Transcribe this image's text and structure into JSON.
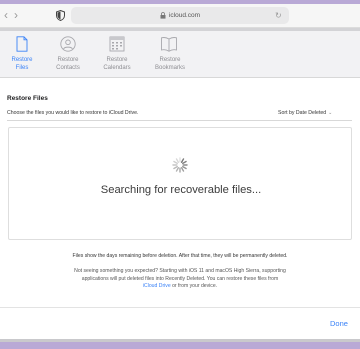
{
  "browser": {
    "url": "icloud.com",
    "back_icon": "chevron-left-icon",
    "forward_icon": "chevron-right-icon"
  },
  "tabs": [
    {
      "label_line1": "Restore",
      "label_line2": "Files",
      "icon": "document-icon",
      "active": true
    },
    {
      "label_line1": "Restore",
      "label_line2": "Contacts",
      "icon": "contacts-icon",
      "active": false
    },
    {
      "label_line1": "Restore",
      "label_line2": "Calendars",
      "icon": "calendar-icon",
      "active": false
    },
    {
      "label_line1": "Restore",
      "label_line2": "Bookmarks",
      "icon": "book-icon",
      "active": false
    }
  ],
  "main": {
    "title": "Restore Files",
    "instructions": "Choose the files you would like to restore to iCloud Drive.",
    "sort_label": "Sort by Date Deleted",
    "status": "Searching for recoverable files...",
    "days_note": "Files show the days remaining before deletion. After that time, they will be permanently deleted.",
    "not_seeing_1": "Not seeing something you expected? Starting with iOS 11 and macOS High Sierra, supporting",
    "not_seeing_2": "applications will put deleted files into Recently Deleted. You can restore these files from",
    "not_seeing_link": "iCloud Drive",
    "not_seeing_3": " or from your device."
  },
  "footer": {
    "done_label": "Done"
  },
  "colors": {
    "accent": "#3a82f7",
    "inactive": "#8e8e93",
    "desktop": "#b9a9d6"
  }
}
